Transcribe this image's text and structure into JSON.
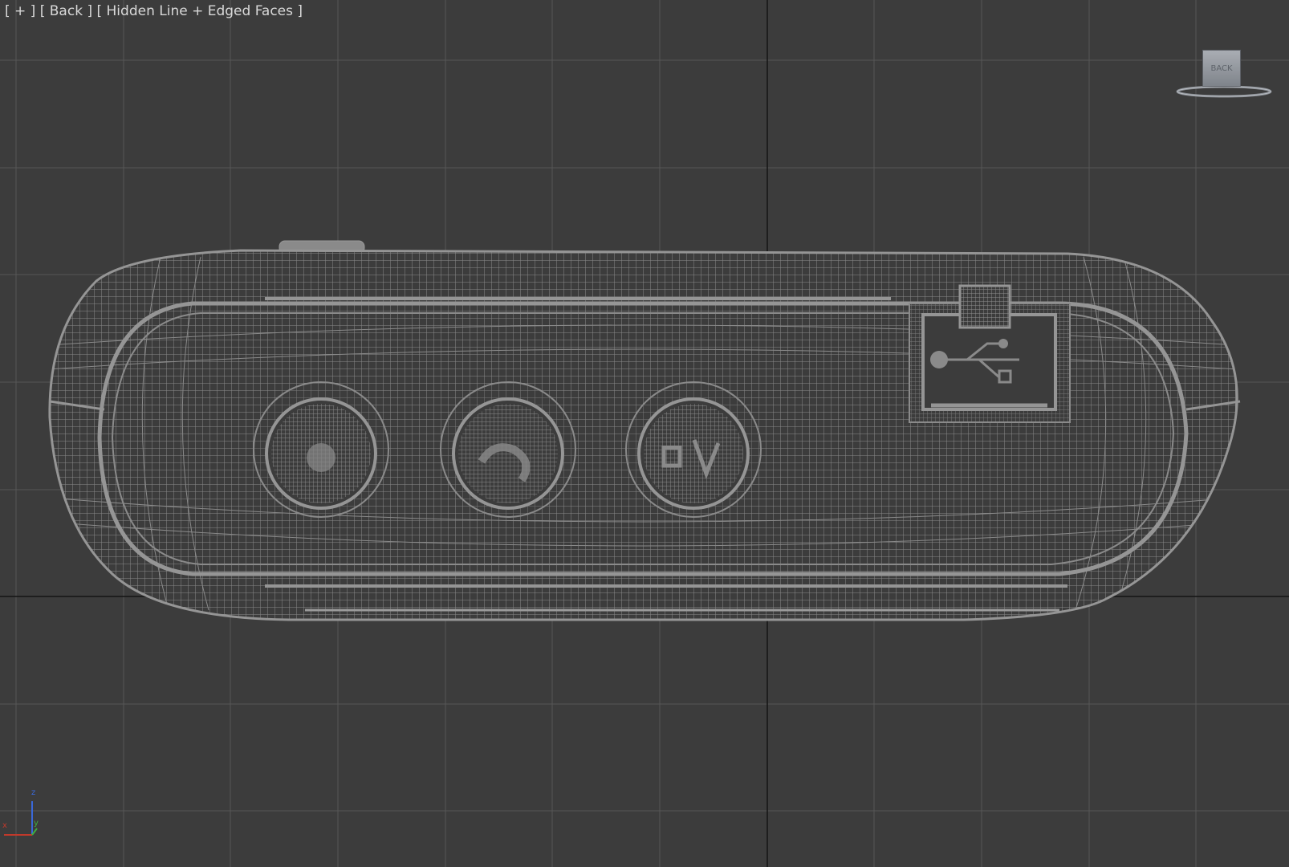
{
  "viewport": {
    "label_parts": [
      "[ + ]",
      "[ Back ]",
      "[ Hidden Line + Edged Faces ]"
    ],
    "background_color": "#3c3c3c",
    "grid_color": "#565656",
    "axis_line_color": "#141414",
    "mesh_color": "#8a8a8a"
  },
  "viewcube": {
    "face_label": "BACK"
  },
  "axis_tripod": {
    "z_label": "z",
    "x_label": "x",
    "y_label": "y",
    "x_color": "#c0392b",
    "y_color": "#3fae3f",
    "z_color": "#3a68d8"
  }
}
